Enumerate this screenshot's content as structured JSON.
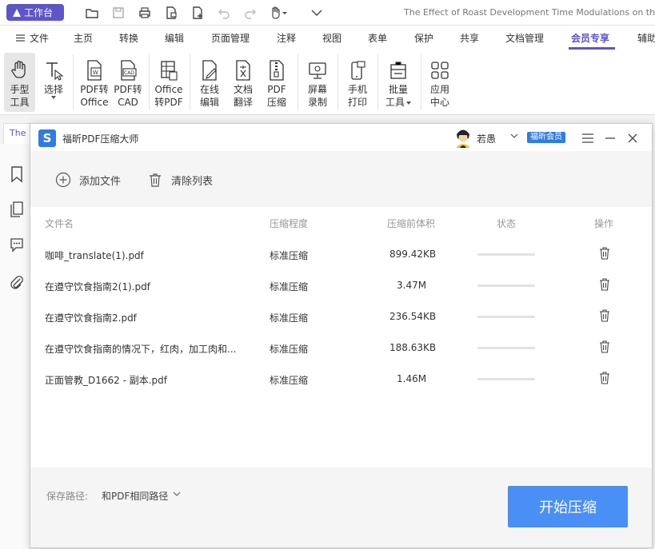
{
  "titlebar": {
    "workbench_label": "工作台",
    "document_title": "The Effect of Roast Development Time Modulations on the Se"
  },
  "menubar": {
    "file_label": "文件",
    "items": [
      "主页",
      "转换",
      "编辑",
      "页面管理",
      "注释",
      "视图",
      "表单",
      "保护",
      "共享",
      "文档管理",
      "会员专享",
      "辅助"
    ],
    "active_item": "会员专享"
  },
  "ribbon": {
    "tools": [
      {
        "label1": "手型",
        "label2": "工具"
      },
      {
        "label1": "选择",
        "label2": ""
      },
      {
        "label1": "PDF转",
        "label2": "Office"
      },
      {
        "label1": "PDF转",
        "label2": "CAD"
      },
      {
        "label1": "Office",
        "label2": "转PDF"
      },
      {
        "label1": "在线",
        "label2": "编辑"
      },
      {
        "label1": "文档",
        "label2": "翻译"
      },
      {
        "label1": "PDF",
        "label2": "压缩"
      },
      {
        "label1": "屏幕",
        "label2": "录制"
      },
      {
        "label1": "手机",
        "label2": "打印"
      },
      {
        "label1": "批量",
        "label2": "工具"
      },
      {
        "label1": "应用",
        "label2": "中心"
      }
    ]
  },
  "doc_tab": {
    "label": "The E"
  },
  "dialog": {
    "title": "福昕PDF压缩大师",
    "logo_letter": "S",
    "username": "若愚",
    "member_badge": "福昕会员",
    "add_file_label": "添加文件",
    "clear_list_label": "清除列表",
    "columns": {
      "filename": "文件名",
      "level": "压缩程度",
      "size": "压缩前体积",
      "status": "状态",
      "action": "操作"
    },
    "files": [
      {
        "name": "咖啡_translate(1).pdf",
        "level": "标准压缩",
        "size": "899.42KB",
        "progress": 0
      },
      {
        "name": "在遵守饮食指南2(1).pdf",
        "level": "标准压缩",
        "size": "3.47M",
        "progress": 0
      },
      {
        "name": "在遵守饮食指南2.pdf",
        "level": "标准压缩",
        "size": "236.54KB",
        "progress": 0
      },
      {
        "name": "在遵守饮食指南的情况下，红肉，加工肉和...",
        "level": "标准压缩",
        "size": "188.63KB",
        "progress": 0
      },
      {
        "name": "正面管教_D1662 - 副本.pdf",
        "level": "标准压缩",
        "size": "1.46M",
        "progress": 0
      }
    ],
    "save_path_label": "保存路径:",
    "save_path_value": "和PDF相同路径",
    "start_button": "开始压缩"
  },
  "colors": {
    "brand_purple": "#5e55c7",
    "accent_blue": "#2f7de1",
    "button_blue": "#4a8ff5"
  },
  "icons": {
    "quick_access": [
      "folder-open-icon",
      "save-icon",
      "print-icon",
      "image-file-icon",
      "new-file-icon",
      "undo-icon",
      "redo-icon",
      "hand-tool-icon",
      "dropdown-icon"
    ],
    "sidebar": [
      "bookmark-icon",
      "pages-icon",
      "comment-icon",
      "attachment-icon"
    ]
  }
}
